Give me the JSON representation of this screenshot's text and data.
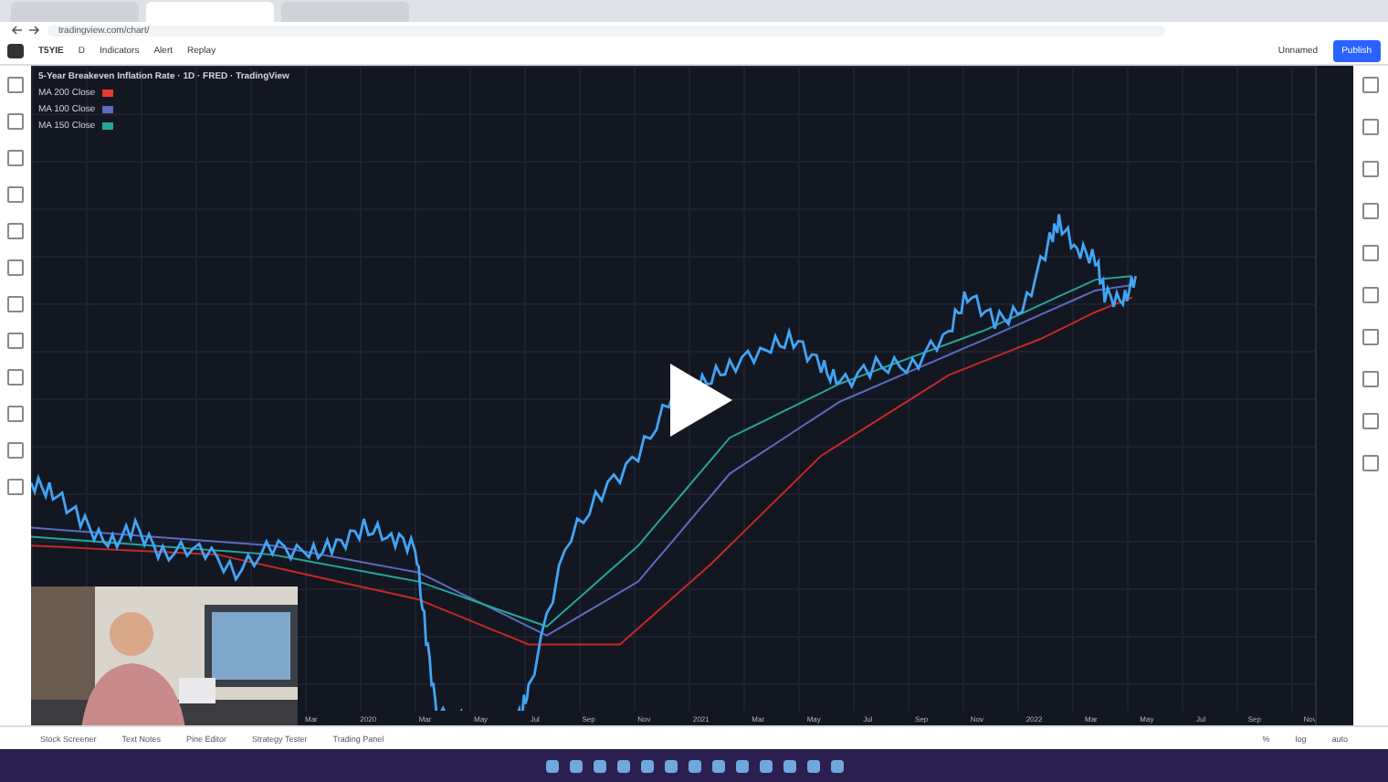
{
  "browser": {
    "tabs": [
      {
        "selected": false
      },
      {
        "selected": true
      },
      {
        "selected": false
      }
    ],
    "url": "tradingview.com/chart/"
  },
  "toolbar": {
    "symbol": "T5YIE",
    "interval": "D",
    "indicators": "Indicators",
    "alert": "Alert",
    "replay": "Replay",
    "layout": "Unnamed",
    "publish": "Publish"
  },
  "chart": {
    "title": "5-Year Breakeven Inflation Rate · 1D · FRED · TradingView",
    "legend": [
      {
        "label": "MA 200 Close",
        "color": "#e53935"
      },
      {
        "label": "MA 100 Close",
        "color": "#5c6bc0"
      },
      {
        "label": "MA 150 Close",
        "color": "#26a69a"
      }
    ],
    "months": [
      "Mar",
      "2020",
      "Mar",
      "May",
      "Jul",
      "Sep",
      "Nov",
      "2021",
      "Mar",
      "May",
      "Jul",
      "Sep",
      "Nov",
      "2022",
      "Mar",
      "May",
      "Jul",
      "Sep",
      "Nov"
    ],
    "axis_controls": [
      "%",
      "log",
      "auto"
    ]
  },
  "bottom_tabs": [
    "Stock Screener",
    "Text Notes",
    "Pine Editor",
    "Strategy Tester",
    "Trading Panel"
  ]
}
